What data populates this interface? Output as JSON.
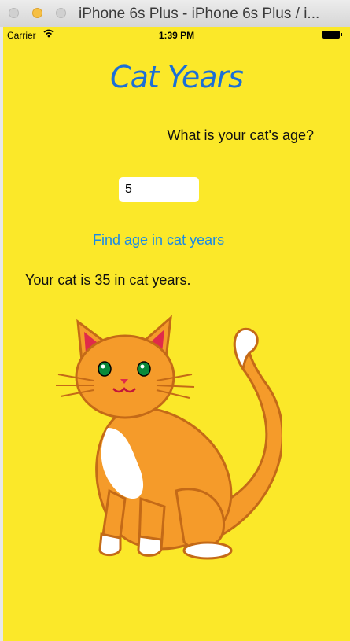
{
  "window": {
    "title": "iPhone 6s Plus - iPhone 6s Plus / i..."
  },
  "status_bar": {
    "carrier": "Carrier",
    "time": "1:39 PM"
  },
  "app": {
    "title": "Cat Years",
    "question": "What is your cat's age?",
    "age_value": "5",
    "find_button_label": "Find age in cat years",
    "result": "Your cat is 35 in cat years."
  },
  "colors": {
    "background": "#fbe829",
    "title": "#1b6fd6",
    "button_text": "#1a8ae6",
    "cat_orange": "#f59b2a",
    "cat_outline": "#c46a17"
  },
  "icons": [
    "wifi-icon",
    "battery-icon",
    "cat-illustration"
  ]
}
